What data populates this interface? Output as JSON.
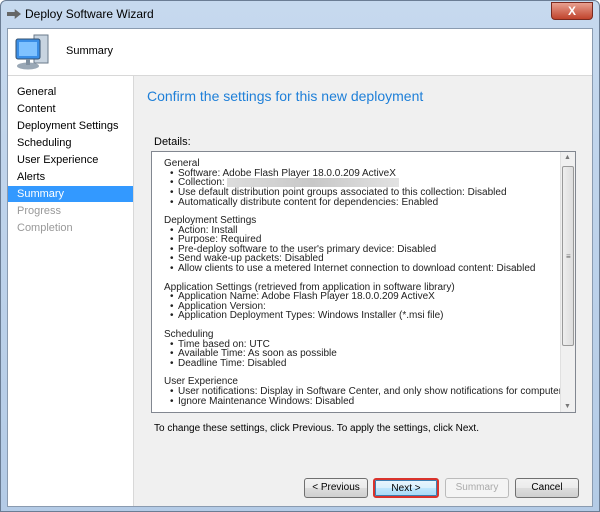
{
  "window": {
    "title": "Deploy Software Wizard",
    "close_label": "X"
  },
  "header": {
    "title": "Summary",
    "icon": "computer-icon"
  },
  "sidebar": {
    "items": [
      {
        "label": "General",
        "state": "normal"
      },
      {
        "label": "Content",
        "state": "normal"
      },
      {
        "label": "Deployment Settings",
        "state": "normal"
      },
      {
        "label": "Scheduling",
        "state": "normal"
      },
      {
        "label": "User Experience",
        "state": "normal"
      },
      {
        "label": "Alerts",
        "state": "normal"
      },
      {
        "label": "Summary",
        "state": "selected"
      },
      {
        "label": "Progress",
        "state": "disabled"
      },
      {
        "label": "Completion",
        "state": "disabled"
      }
    ]
  },
  "main": {
    "heading": "Confirm the settings for this new deployment",
    "details_label": "Details:",
    "sections": [
      {
        "title": "General",
        "items": [
          "Software: Adobe Flash Player 18.0.0.209 ActiveX",
          "Collection:",
          "Use default distribution point groups associated to this collection: Disabled",
          "Automatically distribute content for dependencies: Enabled"
        ]
      },
      {
        "title": "Deployment Settings",
        "items": [
          "Action: Install",
          "Purpose: Required",
          "Pre-deploy software to the user's primary device: Disabled",
          "Send wake-up packets: Disabled",
          "Allow clients to use a metered Internet connection to download content: Disabled"
        ]
      },
      {
        "title": "Application Settings (retrieved from application in software library)",
        "items": [
          "Application Name: Adobe Flash Player 18.0.0.209 ActiveX",
          "Application Version:",
          "Application Deployment Types: Windows Installer (*.msi file)"
        ]
      },
      {
        "title": "Scheduling",
        "items": [
          "Time based on: UTC",
          "Available Time: As soon as possible",
          "Deadline Time: Disabled"
        ]
      },
      {
        "title": "User Experience",
        "items": [
          "User notifications: Display in Software Center, and only show notifications for computer restarts",
          "Ignore Maintenance Windows: Disabled"
        ]
      }
    ],
    "hint": "To change these settings, click Previous. To apply the settings, click Next."
  },
  "buttons": {
    "previous": "< Previous",
    "next": "Next >",
    "summary": "Summary",
    "cancel": "Cancel"
  },
  "colors": {
    "accent": "#1e7fd8",
    "selected": "#3399ff",
    "highlight": "#d9332c"
  }
}
